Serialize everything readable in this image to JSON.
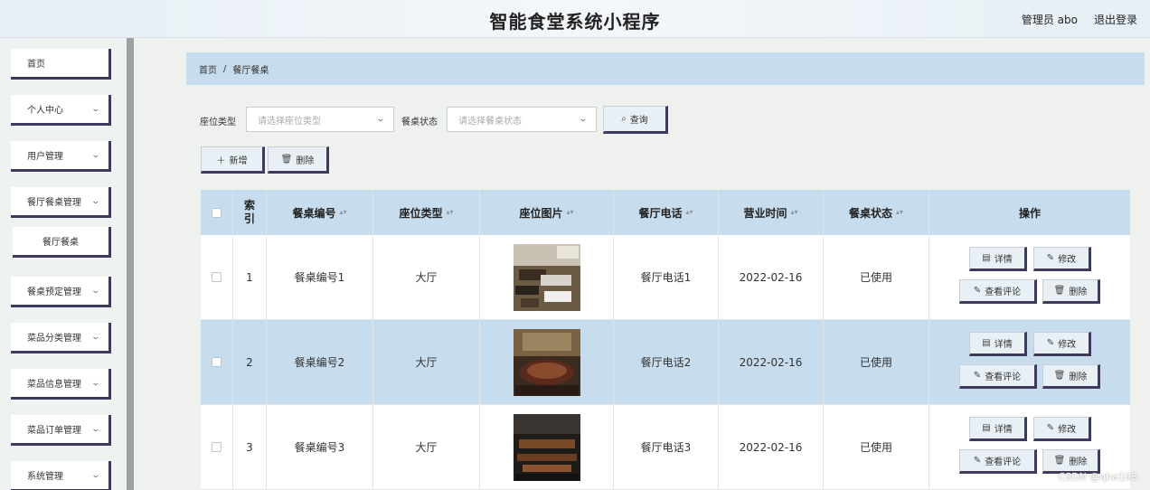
{
  "header": {
    "title": "智能食堂系统小程序",
    "user": "管理员 abo",
    "logout": "退出登录"
  },
  "sidebar": {
    "items": [
      {
        "label": "首页",
        "has_chevron": false
      },
      {
        "label": "个人中心",
        "has_chevron": true
      },
      {
        "label": "用户管理",
        "has_chevron": true
      },
      {
        "label": "餐厅餐桌管理",
        "has_chevron": true
      },
      {
        "label": "餐厅餐桌",
        "has_chevron": false,
        "sub": true
      },
      {
        "label": "餐桌预定管理",
        "has_chevron": true
      },
      {
        "label": "菜品分类管理",
        "has_chevron": true
      },
      {
        "label": "菜品信息管理",
        "has_chevron": true
      },
      {
        "label": "菜品订单管理",
        "has_chevron": true
      },
      {
        "label": "系统管理",
        "has_chevron": true
      }
    ]
  },
  "breadcrumb": {
    "home": "首页",
    "separator": "/",
    "current": "餐厅餐桌"
  },
  "filters": {
    "seat_type_label": "座位类型",
    "seat_type_placeholder": "请选择座位类型",
    "status_label": "餐桌状态",
    "status_placeholder": "请选择餐桌状态",
    "search_button": "查询"
  },
  "toolbar": {
    "add_button": "新增",
    "delete_button": "删除"
  },
  "table": {
    "columns": {
      "index": "索引",
      "table_no": "餐桌编号",
      "seat_type": "座位类型",
      "seat_photo": "座位图片",
      "phone": "餐厅电话",
      "hours": "营业时间",
      "status": "餐桌状态",
      "actions": "操作"
    },
    "actions": {
      "detail": "详情",
      "edit": "修改",
      "reviews": "查看评论",
      "delete": "删除"
    },
    "rows": [
      {
        "index": "1",
        "table_no": "餐桌编号1",
        "seat_type": "大厅",
        "phone": "餐厅电话1",
        "hours": "2022-02-16",
        "status": "已使用"
      },
      {
        "index": "2",
        "table_no": "餐桌编号2",
        "seat_type": "大厅",
        "phone": "餐厅电话2",
        "hours": "2022-02-16",
        "status": "已使用"
      },
      {
        "index": "3",
        "table_no": "餐桌编号3",
        "seat_type": "大厅",
        "phone": "餐厅电话3",
        "hours": "2022-02-16",
        "status": "已使用"
      }
    ]
  },
  "watermark": "CSDN @qha103"
}
